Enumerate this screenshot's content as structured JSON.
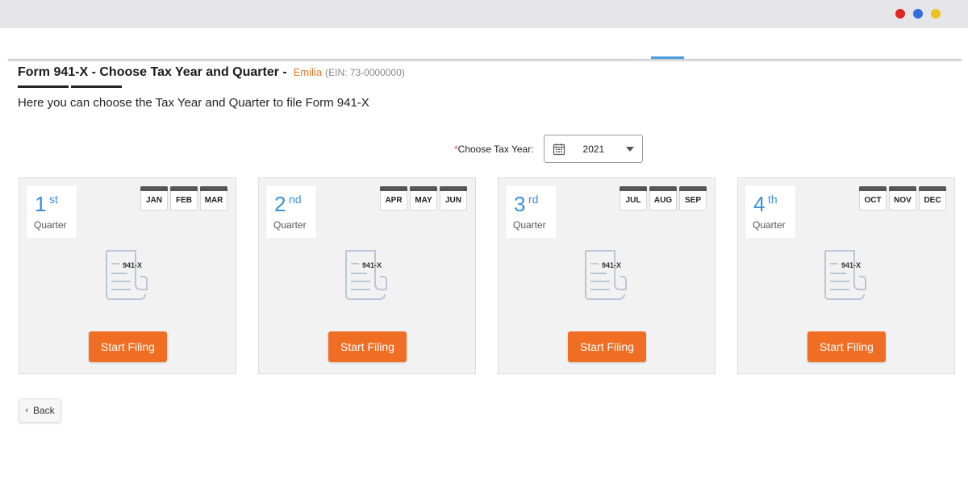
{
  "window": {
    "dot_colors": [
      "#e02626",
      "#2f6fe0",
      "#f0c020"
    ]
  },
  "header": {
    "title": "Form 941-X - Choose Tax Year and Quarter -",
    "company": "Emilia",
    "ein": "(EIN: 73-0000000)",
    "subtitle": "Here you can choose the Tax Year and Quarter to file Form 941-X"
  },
  "tax_year": {
    "required_mark": "*",
    "label": "Choose Tax Year:",
    "value": "2021",
    "icon": "calendar-icon"
  },
  "quarters": [
    {
      "num": "1",
      "sup": "st",
      "label": "Quarter",
      "months": [
        "JAN",
        "FEB",
        "MAR"
      ],
      "form": "941-X",
      "button": "Start Filing"
    },
    {
      "num": "2",
      "sup": "nd",
      "label": "Quarter",
      "months": [
        "APR",
        "MAY",
        "JUN"
      ],
      "form": "941-X",
      "button": "Start Filing"
    },
    {
      "num": "3",
      "sup": "rd",
      "label": "Quarter",
      "months": [
        "JUL",
        "AUG",
        "SEP"
      ],
      "form": "941-X",
      "button": "Start Filing"
    },
    {
      "num": "4",
      "sup": "th",
      "label": "Quarter",
      "months": [
        "OCT",
        "NOV",
        "DEC"
      ],
      "form": "941-X",
      "button": "Start Filing"
    }
  ],
  "footer": {
    "back_label": "Back",
    "back_icon": "chevron-left-icon"
  },
  "colors": {
    "accent_orange": "#f06e24",
    "quarter_blue": "#3d8fd9",
    "company_orange": "#e5782a"
  }
}
